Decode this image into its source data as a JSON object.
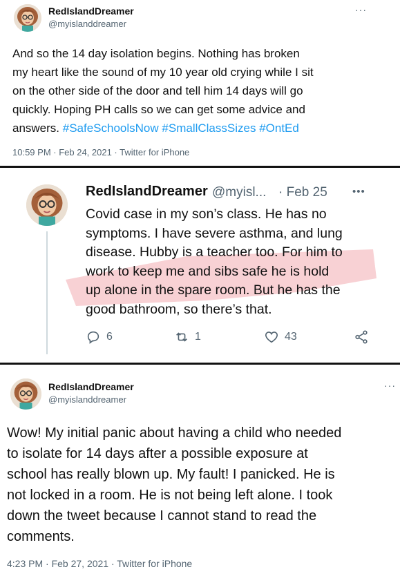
{
  "tweet1": {
    "name": "RedIslandDreamer",
    "handle": "@myislanddreamer",
    "more": "···",
    "text_lines": [
      "And so the 14 day isolation begins. Nothing has broken",
      "my heart like the sound of my 10 year old crying while I sit",
      "on the other side of the door and tell him 14 days will go",
      "quickly. Hoping PH calls so we can get some advice and"
    ],
    "last_line_prefix": "answers. ",
    "hashtags": [
      "#SafeSchoolsNow",
      "#SmallClassSizes",
      "#OntEd"
    ],
    "meta": "10:59 PM · Feb 24, 2021 · Twitter for iPhone"
  },
  "tweet2": {
    "name": "RedIslandDreamer",
    "handle": "@myisl...",
    "date": "· Feb 25",
    "more": "•••",
    "text_lines": [
      "Covid case in my son’s class. He has no",
      "symptoms. I have severe asthma, and lung",
      "disease. Hubby is a teacher too. For him to",
      "work to keep me and sibs safe he is hold",
      "up alone in the spare room. But he has the",
      "good bathroom, so there’s that."
    ],
    "replies": "6",
    "retweets": "1",
    "likes": "43",
    "highlight_color": "#f7c9cc"
  },
  "tweet3": {
    "name": "RedIslandDreamer",
    "handle": "@myislanddreamer",
    "more": "···",
    "text_lines": [
      "Wow! My initial panic about having a child who needed",
      "to isolate for 14 days after a possible exposure at",
      "school has really blown up. My fault! I panicked. He is",
      "not locked in a room. He is not being left alone. I took",
      "down the tweet because I cannot stand to read the",
      "comments."
    ],
    "meta": "4:23 PM · Feb 27, 2021 · Twitter for iPhone"
  },
  "colors": {
    "link": "#1d9bf0",
    "muted": "#536471",
    "divider": "#111111"
  }
}
